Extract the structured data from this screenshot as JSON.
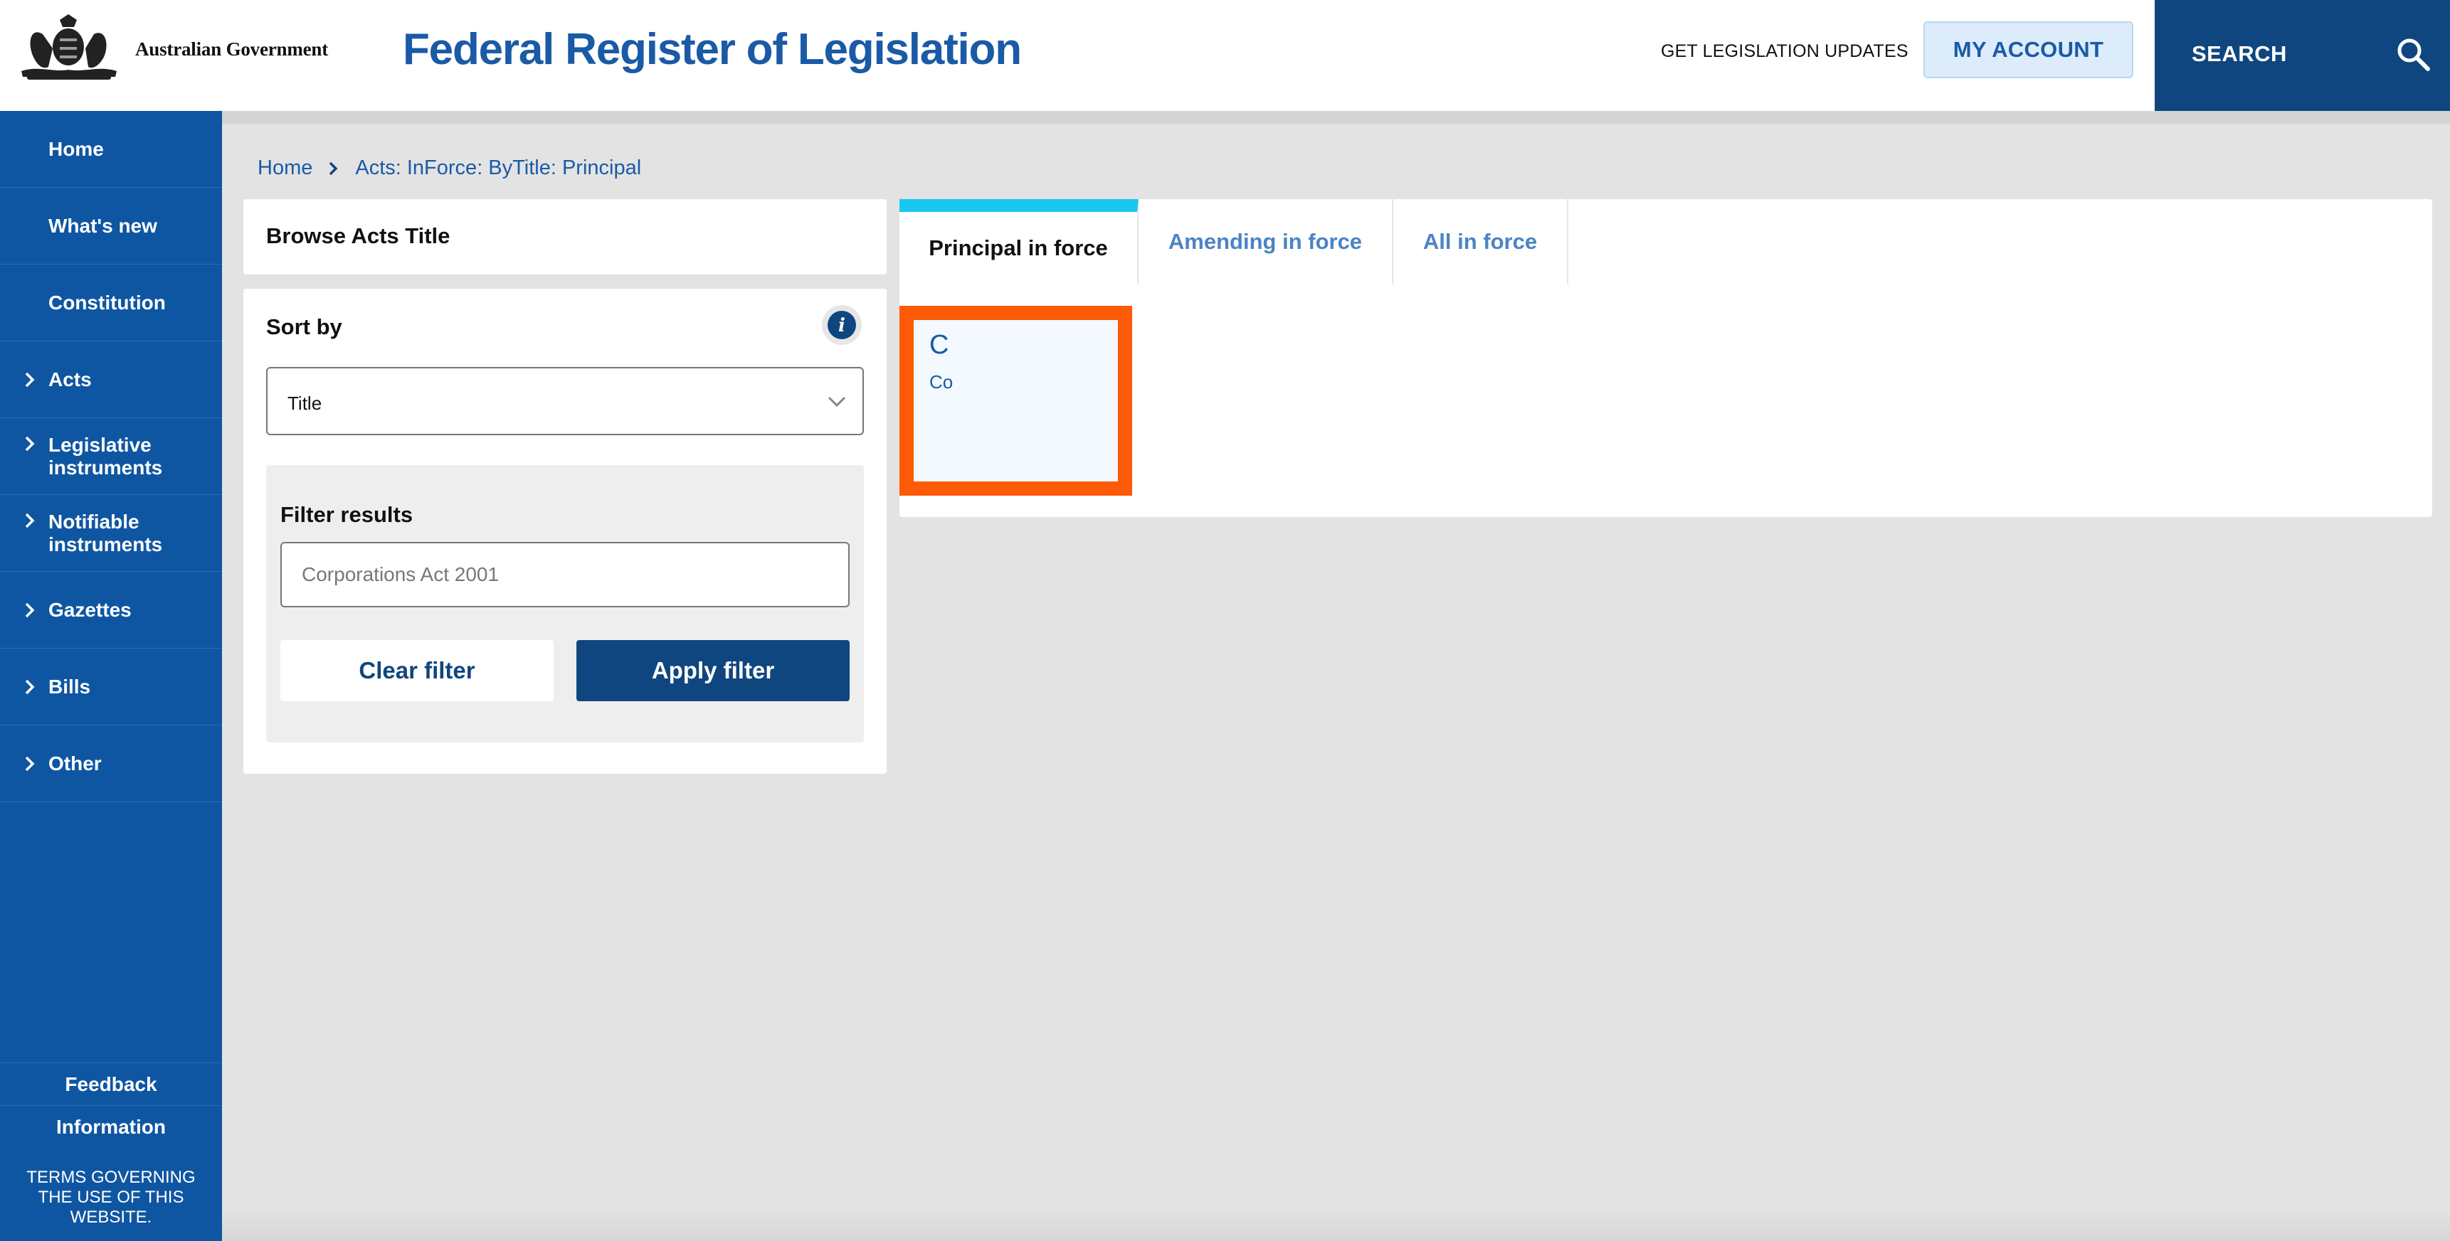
{
  "header": {
    "gov_name": "Australian Government",
    "site_title": "Federal Register of Legislation",
    "updates_link": "GET LEGISLATION UPDATES",
    "account_button": "MY ACCOUNT",
    "search_button": "SEARCH"
  },
  "sidebar": {
    "items": [
      {
        "label": "Home",
        "has_chevron": false
      },
      {
        "label": "What's new",
        "has_chevron": false
      },
      {
        "label": "Constitution",
        "has_chevron": false
      },
      {
        "label": "Acts",
        "has_chevron": true
      },
      {
        "label": "Legislative instruments",
        "has_chevron": true
      },
      {
        "label": "Notifiable instruments",
        "has_chevron": true
      },
      {
        "label": "Gazettes",
        "has_chevron": true
      },
      {
        "label": "Bills",
        "has_chevron": true
      },
      {
        "label": "Other",
        "has_chevron": true
      }
    ],
    "footer": {
      "feedback": "Feedback",
      "information": "Information",
      "terms": "TERMS GOVERNING THE USE OF THIS WEBSITE."
    }
  },
  "breadcrumb": {
    "home": "Home",
    "current": "Acts: InForce: ByTitle: Principal"
  },
  "browse": {
    "title": "Browse Acts Title"
  },
  "sort": {
    "label": "Sort by",
    "selected": "Title"
  },
  "filter": {
    "label": "Filter results",
    "placeholder": "Corporations Act 2001",
    "value": "",
    "clear_label": "Clear filter",
    "apply_label": "Apply filter"
  },
  "tabs": [
    {
      "label": "Principal in force",
      "active": true
    },
    {
      "label": "Amending in force",
      "active": false
    },
    {
      "label": "All in force",
      "active": false
    }
  ],
  "result_tile": {
    "letter": "C",
    "text": "Co"
  },
  "colors": {
    "brand_blue": "#10467f",
    "sidebar_blue": "#0f56a2",
    "link_blue": "#1a5aa6",
    "tab_accent": "#19c6f0",
    "highlight": "#fd5a07"
  }
}
